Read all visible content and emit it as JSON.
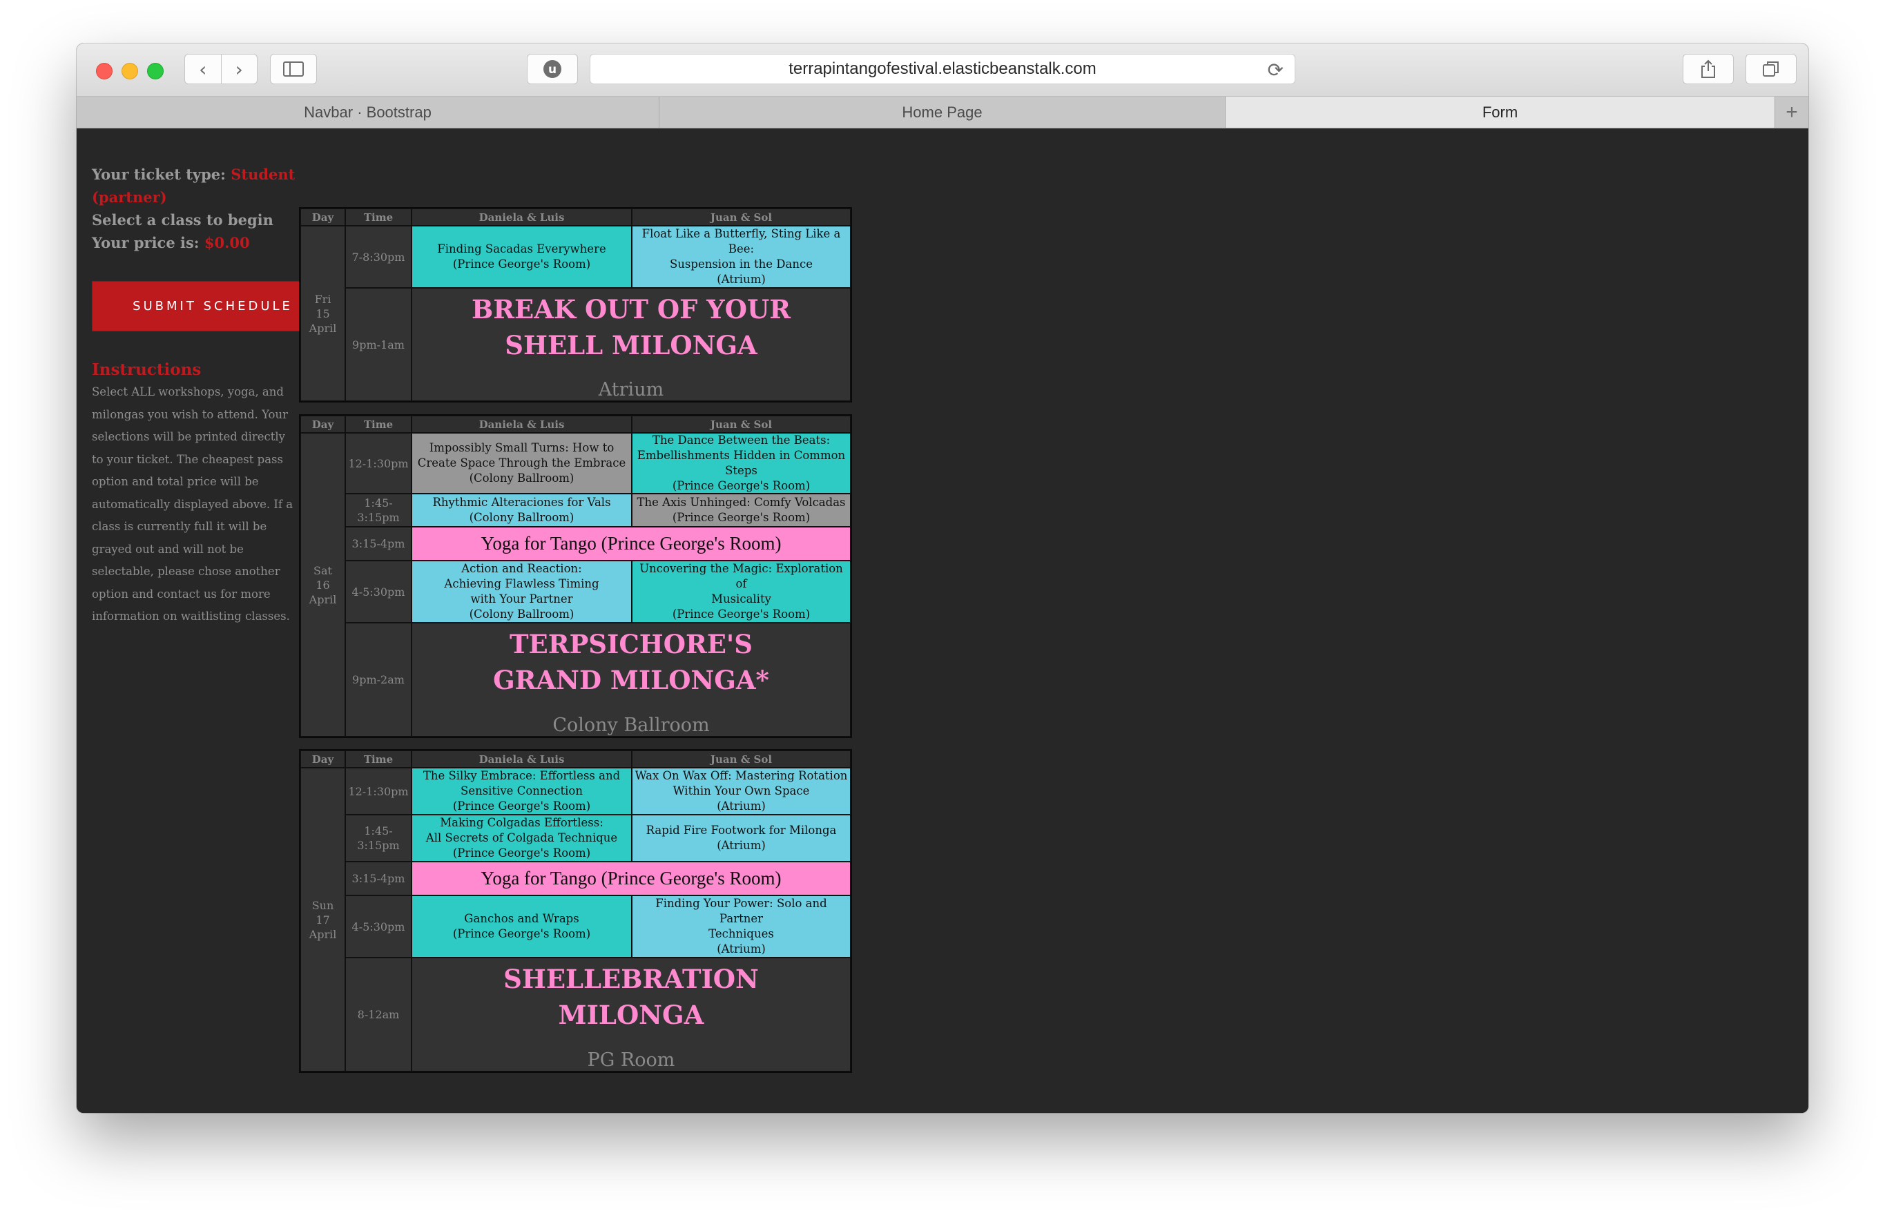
{
  "browser": {
    "url": "terrapintangofestival.elasticbeanstalk.com",
    "tabs": [
      {
        "label": "Navbar · Bootstrap",
        "active": false
      },
      {
        "label": "Home Page",
        "active": false
      },
      {
        "label": "Form",
        "active": true
      }
    ]
  },
  "sidebar": {
    "ticket_label": "Your ticket type:",
    "ticket_type": "Student (partner)",
    "select_prompt": "Select a class to begin",
    "price_label": "Your price is:",
    "price_value": "$0.00",
    "submit_label": "SUBMIT SCHEDULE",
    "instructions_title": "Instructions",
    "instructions_text": "Select ALL workshops, yoga, and milongas you wish to attend. Your selections will be printed directly to your ticket. The cheapest pass option and total price will be automatically displayed above. If a class is currently full it will be grayed out and will not be selectable, please chose another option and contact us for more information on waitlisting classes."
  },
  "headers": {
    "day": "Day",
    "time": "Time",
    "col1": "Daniela & Luis",
    "col2": "Juan & Sol"
  },
  "friday": {
    "day": "Fri\n15\nApril",
    "rows": [
      {
        "time": "7-8:30pm",
        "c1": "Finding Sacadas Everywhere\n(Prince George's Room)",
        "c2": "Float Like a Butterfly, Sting Like a Bee:\nSuspension in the Dance\n(Atrium)"
      },
      {
        "time": "9pm-1am",
        "title": "BREAK OUT OF YOUR\nSHELL MILONGA",
        "place": "Atrium"
      }
    ]
  },
  "saturday": {
    "day": "Sat\n16\nApril",
    "rows": [
      {
        "time": "12-1:30pm",
        "c1": "Impossibly Small Turns: How to Create Space Through the Embrace\n(Colony Ballroom)",
        "c2": "The Dance Between the Beats: Embellishments Hidden in Common Steps\n(Prince George's Room)"
      },
      {
        "time": "1:45-\n3:15pm",
        "c1": "Rhythmic Alteraciones for Vals\n(Colony Ballroom)",
        "c2": "The Axis Unhinged: Comfy Volcadas\n(Prince George's Room)"
      },
      {
        "time": "3:15-4pm",
        "yoga": "Yoga for Tango (Prince George's Room)"
      },
      {
        "time": "4-5:30pm",
        "c1": "Action and Reaction:\nAchieving Flawless Timing\nwith Your Partner\n(Colony Ballroom)",
        "c2": "Uncovering the Magic: Exploration of\nMusicality\n(Prince George's Room)"
      },
      {
        "time": "9pm-2am",
        "title": "TERPSICHORE'S\nGRAND MILONGA*",
        "place": "Colony Ballroom"
      }
    ]
  },
  "sunday": {
    "day": "Sun\n17\nApril",
    "rows": [
      {
        "time": "12-1:30pm",
        "c1": "The Silky Embrace: Effortless and Sensitive Connection\n(Prince George's Room)",
        "c2": "Wax On Wax Off: Mastering Rotation Within Your Own Space\n(Atrium)"
      },
      {
        "time": "1:45-\n3:15pm",
        "c1": "Making Colgadas Effortless:\nAll Secrets of Colgada Technique\n(Prince George's Room)",
        "c2": "Rapid Fire Footwork for Milonga\n(Atrium)"
      },
      {
        "time": "3:15-4pm",
        "yoga": "Yoga for Tango (Prince George's Room)"
      },
      {
        "time": "4-5:30pm",
        "c1": "Ganchos and Wraps\n(Prince George's Room)",
        "c2": "Finding Your Power: Solo and Partner\nTechniques\n(Atrium)"
      },
      {
        "time": "8-12am",
        "title": "SHELLEBRATION\nMILONGA",
        "place": "PG Room"
      }
    ]
  },
  "colors": {
    "teal": "#2ecac4",
    "light_blue": "#6fcfe2",
    "full_grey": "#979797",
    "pink": "#ff8acf",
    "accent_red": "#c0191e"
  }
}
